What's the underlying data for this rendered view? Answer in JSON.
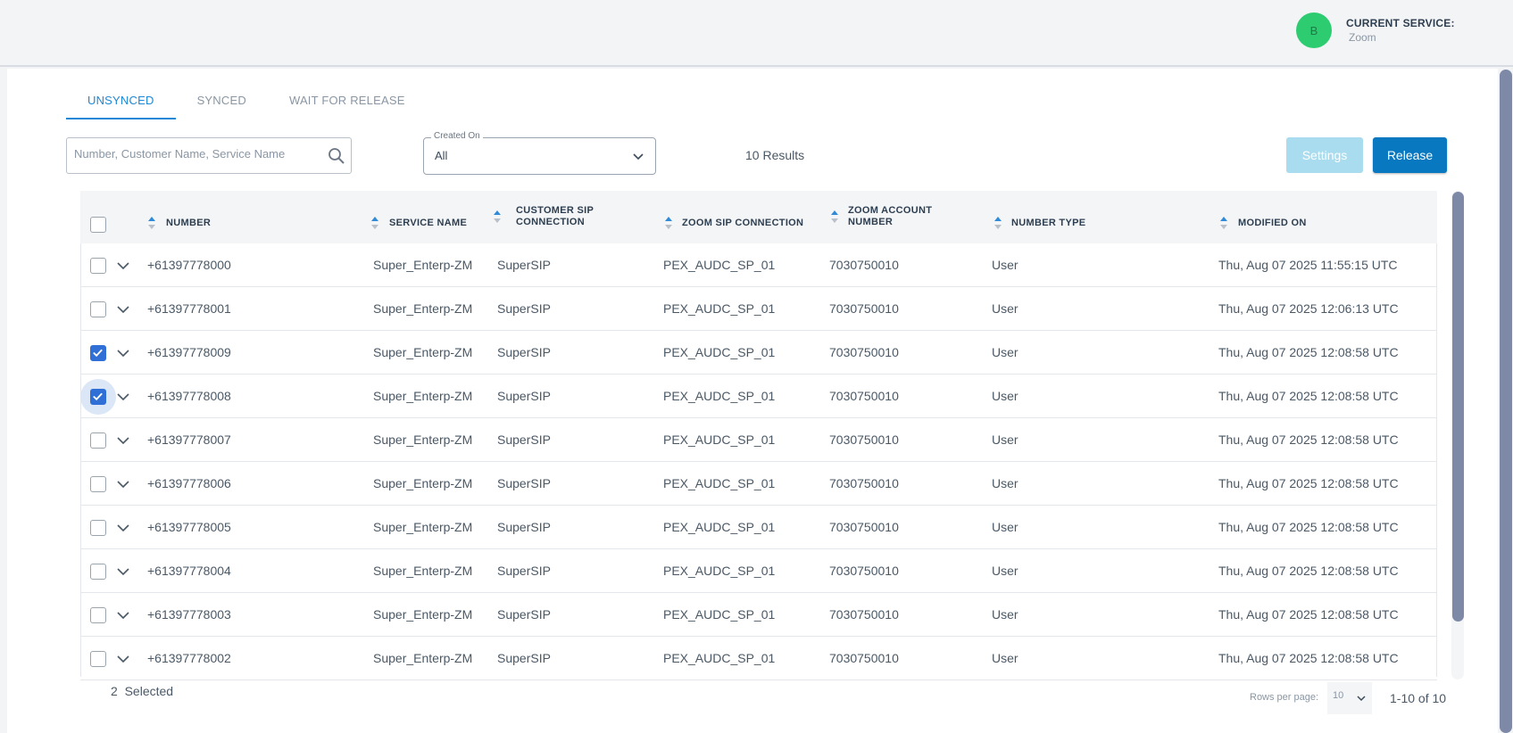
{
  "header": {
    "avatar_initial": "B",
    "service_label": "CURRENT SERVICE:",
    "service_value": "Zoom"
  },
  "tabs": [
    {
      "label": "UNSYNCED",
      "active": true
    },
    {
      "label": "SYNCED",
      "active": false
    },
    {
      "label": "WAIT FOR RELEASE",
      "active": false
    }
  ],
  "search": {
    "placeholder": "Number, Customer Name, Service Name",
    "value": ""
  },
  "filter": {
    "label": "Created On",
    "value": "All"
  },
  "results_text": "10 Results",
  "buttons": {
    "settings": "Settings",
    "release": "Release"
  },
  "columns": {
    "number": "NUMBER",
    "service_name": "SERVICE NAME",
    "customer_sip_1": "CUSTOMER SIP",
    "customer_sip_2": "CONNECTION",
    "zoom_sip": "ZOOM SIP CONNECTION",
    "zoom_account_1": "ZOOM ACCOUNT",
    "zoom_account_2": "NUMBER",
    "number_type": "NUMBER TYPE",
    "modified_on": "MODIFIED ON"
  },
  "rows": [
    {
      "checked": false,
      "number": "+61397778000",
      "service": "Super_Enterp-ZM",
      "customer_sip": "SuperSIP",
      "zoom_sip": "PEX_AUDC_SP_01",
      "account": "7030750010",
      "type": "User",
      "modified": "Thu, Aug 07 2025 11:55:15 UTC"
    },
    {
      "checked": false,
      "number": "+61397778001",
      "service": "Super_Enterp-ZM",
      "customer_sip": "SuperSIP",
      "zoom_sip": "PEX_AUDC_SP_01",
      "account": "7030750010",
      "type": "User",
      "modified": "Thu, Aug 07 2025 12:06:13 UTC"
    },
    {
      "checked": true,
      "number": "+61397778009",
      "service": "Super_Enterp-ZM",
      "customer_sip": "SuperSIP",
      "zoom_sip": "PEX_AUDC_SP_01",
      "account": "7030750010",
      "type": "User",
      "modified": "Thu, Aug 07 2025 12:08:58 UTC"
    },
    {
      "checked": true,
      "focused": true,
      "number": "+61397778008",
      "service": "Super_Enterp-ZM",
      "customer_sip": "SuperSIP",
      "zoom_sip": "PEX_AUDC_SP_01",
      "account": "7030750010",
      "type": "User",
      "modified": "Thu, Aug 07 2025 12:08:58 UTC"
    },
    {
      "checked": false,
      "number": "+61397778007",
      "service": "Super_Enterp-ZM",
      "customer_sip": "SuperSIP",
      "zoom_sip": "PEX_AUDC_SP_01",
      "account": "7030750010",
      "type": "User",
      "modified": "Thu, Aug 07 2025 12:08:58 UTC"
    },
    {
      "checked": false,
      "number": "+61397778006",
      "service": "Super_Enterp-ZM",
      "customer_sip": "SuperSIP",
      "zoom_sip": "PEX_AUDC_SP_01",
      "account": "7030750010",
      "type": "User",
      "modified": "Thu, Aug 07 2025 12:08:58 UTC"
    },
    {
      "checked": false,
      "number": "+61397778005",
      "service": "Super_Enterp-ZM",
      "customer_sip": "SuperSIP",
      "zoom_sip": "PEX_AUDC_SP_01",
      "account": "7030750010",
      "type": "User",
      "modified": "Thu, Aug 07 2025 12:08:58 UTC"
    },
    {
      "checked": false,
      "number": "+61397778004",
      "service": "Super_Enterp-ZM",
      "customer_sip": "SuperSIP",
      "zoom_sip": "PEX_AUDC_SP_01",
      "account": "7030750010",
      "type": "User",
      "modified": "Thu, Aug 07 2025 12:08:58 UTC"
    },
    {
      "checked": false,
      "number": "+61397778003",
      "service": "Super_Enterp-ZM",
      "customer_sip": "SuperSIP",
      "zoom_sip": "PEX_AUDC_SP_01",
      "account": "7030750010",
      "type": "User",
      "modified": "Thu, Aug 07 2025 12:08:58 UTC"
    },
    {
      "checked": false,
      "number": "+61397778002",
      "service": "Super_Enterp-ZM",
      "customer_sip": "SuperSIP",
      "zoom_sip": "PEX_AUDC_SP_01",
      "account": "7030750010",
      "type": "User",
      "modified": "Thu, Aug 07 2025 12:08:58 UTC"
    }
  ],
  "footer": {
    "selected_count": "2",
    "selected_label": "Selected",
    "rows_per_page_label": "Rows per page:",
    "rows_per_page_value": "10",
    "range": "1-10 of 10"
  },
  "colors": {
    "accent": "#1e88d6",
    "release": "#0878c1",
    "settings_disabled": "#a9dcef",
    "avatar": "#2ecc71",
    "checkbox_checked": "#2f6fd6"
  }
}
